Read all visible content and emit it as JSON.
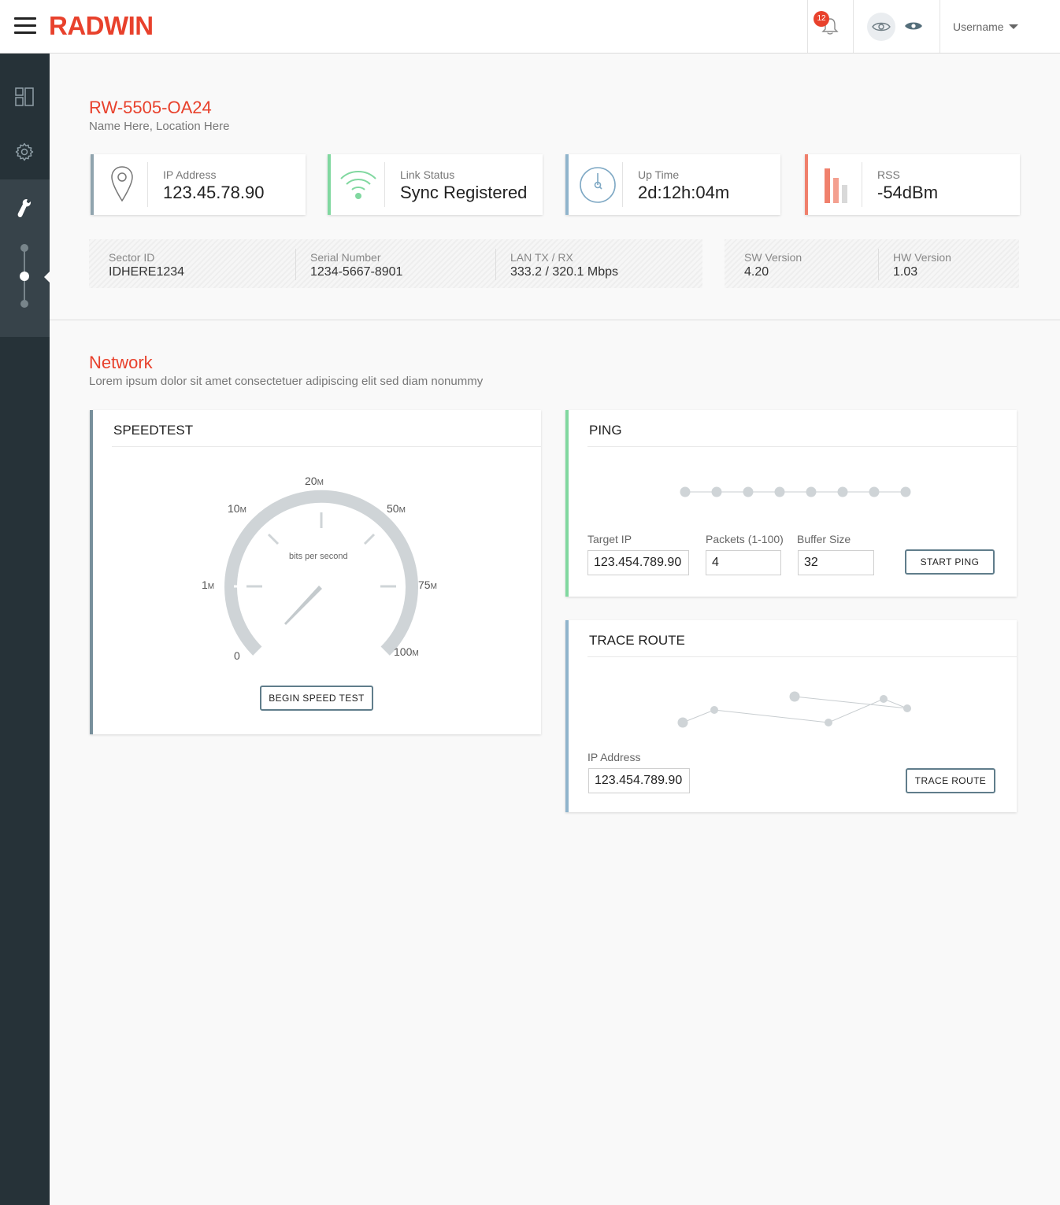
{
  "header": {
    "logo": "RADWIN",
    "notifications_count": "12",
    "username": "Username"
  },
  "sidebar": {
    "items": [
      {
        "icon": "dashboard-icon"
      },
      {
        "icon": "gear-icon"
      },
      {
        "icon": "wrench-icon"
      }
    ]
  },
  "device": {
    "title": "RW-5505-OA24",
    "subtitle": "Name Here, Location Here"
  },
  "kpis": [
    {
      "label": "IP Address",
      "value": "123.45.78.90",
      "icon": "location-pin-icon",
      "accent": "#90a4ae"
    },
    {
      "label": "Link Status",
      "value": "Sync Registered",
      "icon": "wifi-icon",
      "accent": "#81d8a0"
    },
    {
      "label": "Up Time",
      "value": "2d:12h:04m",
      "icon": "clock-icon",
      "accent": "#90b4cc"
    },
    {
      "label": "RSS",
      "value": "-54dBm",
      "icon": "signal-bars-icon",
      "accent": "#f0806c"
    }
  ],
  "info": {
    "sector_id": {
      "label": "Sector ID",
      "value": "IDHERE1234"
    },
    "serial_number": {
      "label": "Serial Number",
      "value": "1234-5667-8901"
    },
    "lan": {
      "label": "LAN TX / RX",
      "value": "333.2 / 320.1 Mbps"
    },
    "sw_version": {
      "label": "SW Version",
      "value": "4.20"
    },
    "hw_version": {
      "label": "HW Version",
      "value": "1.03"
    }
  },
  "network": {
    "title": "Network",
    "subtitle": "Lorem ipsum dolor sit amet consectetuer adipiscing elit sed diam nonummy"
  },
  "speedtest": {
    "title": "SPEEDTEST",
    "unit_caption": "bits per second",
    "scale": [
      {
        "num": "0",
        "unit": ""
      },
      {
        "num": "1",
        "unit": "M"
      },
      {
        "num": "10",
        "unit": "M"
      },
      {
        "num": "20",
        "unit": "M"
      },
      {
        "num": "50",
        "unit": "M"
      },
      {
        "num": "75",
        "unit": "M"
      },
      {
        "num": "100",
        "unit": "M"
      }
    ],
    "button": "BEGIN SPEED TEST"
  },
  "ping": {
    "title": "PING",
    "target_ip_label": "Target IP",
    "target_ip_value": "123.454.789.90",
    "packets_label": "Packets (1-100)",
    "packets_value": "4",
    "buffer_label": "Buffer Size",
    "buffer_value": "32",
    "button": "START PING"
  },
  "trace_route": {
    "title": "TRACE ROUTE",
    "ip_label": "IP Address",
    "ip_value": "123.454.789.90",
    "button": "TRACE ROUTE"
  },
  "colors": {
    "brand": "#e8412c",
    "sidebar": "#263238",
    "green": "#81d8a0",
    "blue": "#90b4cc",
    "salmon": "#f0806c"
  }
}
